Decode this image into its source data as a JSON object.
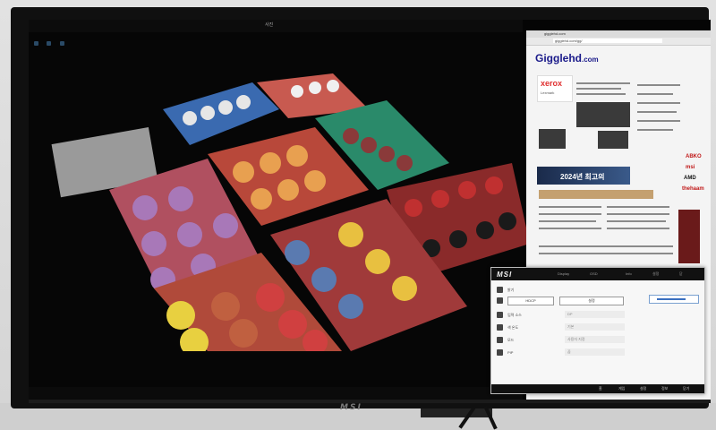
{
  "viewer": {
    "title": "사진",
    "footer": "",
    "accent": "#2a4a66"
  },
  "browser": {
    "tab_label": "gigglehd.com",
    "url": "gigglehd.com/gg/",
    "site_name": "Gigglehd",
    "site_tld": ".com",
    "ad_brand": "xerox",
    "ad_sub": "Lexmark",
    "banner_text": "2024년 최고의",
    "side_logos": [
      "ABKO",
      "msi",
      "AMD",
      "thehaam"
    ],
    "colors": {
      "site": "#1a1a8a",
      "xerox": "#e03030"
    }
  },
  "dialog": {
    "logo": "MSI",
    "tabs": [
      "Display",
      "OSD",
      "Info",
      "설정",
      "닫"
    ],
    "rows": [
      {
        "icon": "brightness-icon",
        "label": "밝기",
        "button": "",
        "select": ""
      },
      {
        "icon": "display-icon",
        "label": "",
        "button": "HDCP",
        "select": "설정"
      },
      {
        "icon": "input-icon",
        "label": "입력 소스",
        "button": "",
        "select": "DP"
      },
      {
        "icon": "color-icon",
        "label": "색 온도",
        "button": "",
        "select": "기본"
      },
      {
        "icon": "mode-icon",
        "label": "모드",
        "button": "",
        "select": "사용자 지정"
      },
      {
        "icon": "pip-icon",
        "label": "PIP",
        "button": "",
        "select": "끔"
      }
    ],
    "slider_level": 0.8,
    "footer": [
      "홈",
      "게임",
      "설정",
      "정보",
      "닫기"
    ]
  },
  "taskbar": {
    "time": ""
  },
  "monitor_brand": "MSI"
}
